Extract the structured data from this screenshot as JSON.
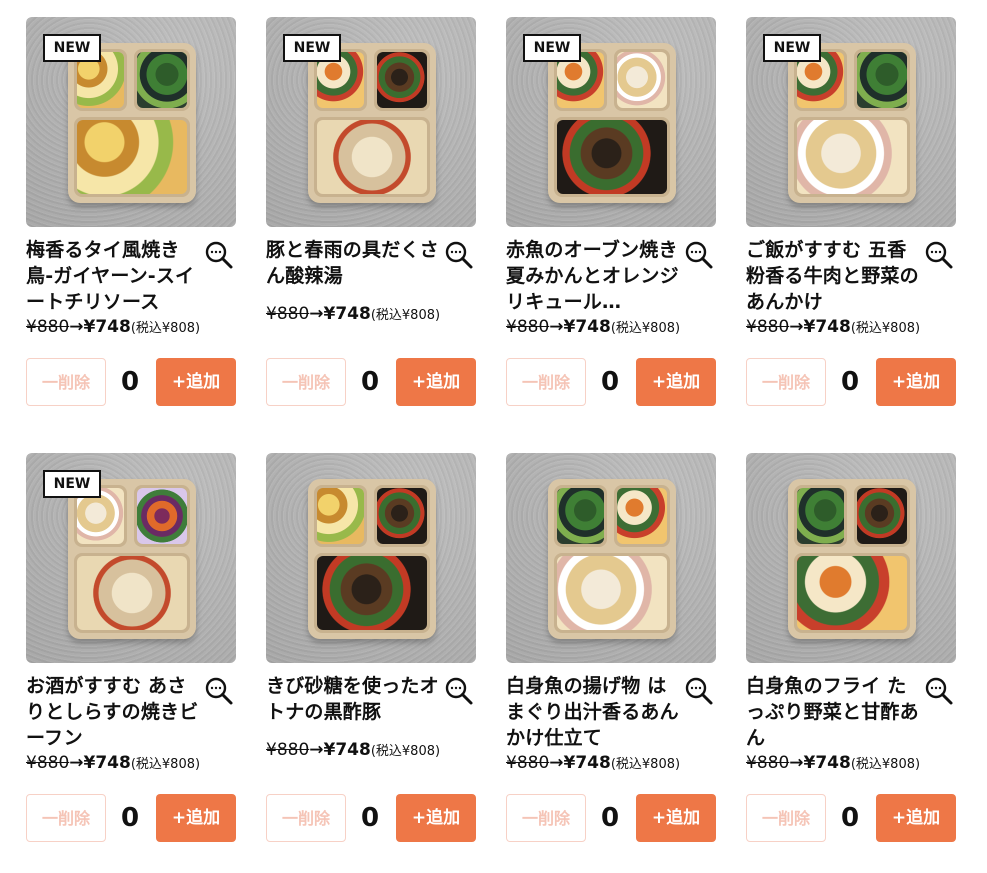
{
  "ui": {
    "remove_label": "一削除",
    "add_label": "+追加"
  },
  "colors": {
    "accent": "#ee7747",
    "remove_border": "#f7d1c6",
    "remove_text": "#f5c4b6"
  },
  "products": [
    {
      "badge": "NEW",
      "title": "梅香るタイ風焼き鳥-ガイヤーン-スイートチリソース",
      "price_old": "¥880",
      "price_arrow": "→",
      "price_new": "¥748",
      "price_tax": "(税込¥808)",
      "quantity": "0"
    },
    {
      "badge": "NEW",
      "title": "豚と春雨の具だくさん酸辣湯",
      "price_old": "¥880",
      "price_arrow": "→",
      "price_new": "¥748",
      "price_tax": "(税込¥808)",
      "quantity": "0"
    },
    {
      "badge": "NEW",
      "title": "赤魚のオーブン焼き 夏みかんとオレンジリキュール…",
      "price_old": "¥880",
      "price_arrow": "→",
      "price_new": "¥748",
      "price_tax": "(税込¥808)",
      "quantity": "0"
    },
    {
      "badge": "NEW",
      "title": "ご飯がすすむ 五香粉香る牛肉と野菜のあんかけ",
      "price_old": "¥880",
      "price_arrow": "→",
      "price_new": "¥748",
      "price_tax": "(税込¥808)",
      "quantity": "0"
    },
    {
      "badge": "NEW",
      "title": "お酒がすすむ あさりとしらすの焼きビーフン",
      "price_old": "¥880",
      "price_arrow": "→",
      "price_new": "¥748",
      "price_tax": "(税込¥808)",
      "quantity": "0"
    },
    {
      "badge": "",
      "title": "きび砂糖を使ったオトナの黒酢豚",
      "price_old": "¥880",
      "price_arrow": "→",
      "price_new": "¥748",
      "price_tax": "(税込¥808)",
      "quantity": "0"
    },
    {
      "badge": "",
      "title": "白身魚の揚げ物 はまぐり出汁香るあんかけ仕立て",
      "price_old": "¥880",
      "price_arrow": "→",
      "price_new": "¥748",
      "price_tax": "(税込¥808)",
      "quantity": "0"
    },
    {
      "badge": "",
      "title": "白身魚のフライ たっぷり野菜と甘酢あん",
      "price_old": "¥880",
      "price_arrow": "→",
      "price_new": "¥748",
      "price_tax": "(税込¥808)",
      "quantity": "0"
    }
  ]
}
